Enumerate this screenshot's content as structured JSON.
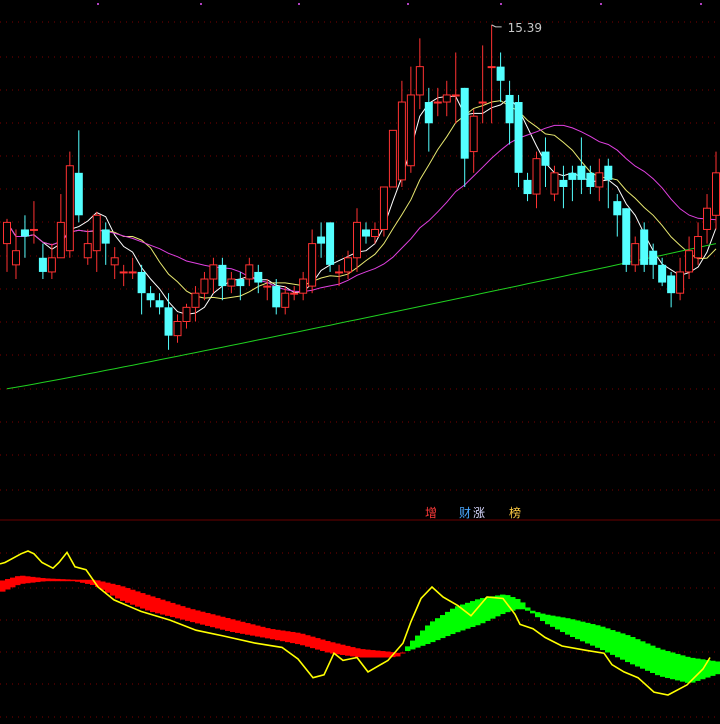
{
  "chart_data": {
    "type": "candlestick",
    "price_ylim": [
      9.3,
      15.6
    ],
    "max_label": "15.39",
    "candles": [
      [
        12.3,
        12.6,
        12.65,
        11.9
      ],
      [
        12.0,
        12.2,
        12.5,
        11.8
      ],
      [
        12.5,
        12.4,
        12.7,
        12.1
      ],
      [
        12.5,
        12.5,
        12.9,
        12.3
      ],
      [
        12.1,
        11.9,
        12.3,
        11.8
      ],
      [
        11.9,
        12.1,
        12.3,
        11.8
      ],
      [
        12.1,
        12.6,
        13.0,
        12.1
      ],
      [
        12.2,
        13.4,
        13.6,
        12.1
      ],
      [
        13.3,
        12.7,
        13.9,
        12.6
      ],
      [
        12.1,
        12.3,
        12.5,
        12.0
      ],
      [
        12.2,
        12.7,
        12.75,
        11.9
      ],
      [
        12.5,
        12.3,
        12.6,
        12.0
      ],
      [
        12.0,
        12.1,
        12.25,
        11.8
      ],
      [
        11.9,
        11.9,
        12.0,
        11.7
      ],
      [
        11.9,
        11.9,
        12.1,
        11.8
      ],
      [
        11.9,
        11.6,
        12.0,
        11.3
      ],
      [
        11.6,
        11.5,
        11.7,
        11.4
      ],
      [
        11.5,
        11.4,
        11.6,
        11.3
      ],
      [
        11.4,
        11.0,
        11.6,
        10.8
      ],
      [
        11.0,
        11.2,
        11.3,
        10.9
      ],
      [
        11.2,
        11.4,
        11.45,
        11.1
      ],
      [
        11.4,
        11.6,
        11.7,
        11.2
      ],
      [
        11.6,
        11.8,
        11.9,
        11.5
      ],
      [
        11.8,
        12.0,
        12.1,
        11.6
      ],
      [
        12.0,
        11.7,
        12.1,
        11.5
      ],
      [
        11.7,
        11.8,
        11.9,
        11.6
      ],
      [
        11.8,
        11.7,
        11.9,
        11.5
      ],
      [
        11.8,
        12.0,
        12.1,
        11.7
      ],
      [
        11.9,
        11.75,
        12.0,
        11.6
      ],
      [
        11.7,
        11.7,
        11.8,
        11.5
      ],
      [
        11.7,
        11.4,
        11.8,
        11.3
      ],
      [
        11.4,
        11.6,
        11.7,
        11.3
      ],
      [
        11.6,
        11.6,
        11.7,
        11.5
      ],
      [
        11.6,
        11.8,
        11.9,
        11.5
      ],
      [
        11.7,
        12.3,
        12.5,
        11.6
      ],
      [
        12.4,
        12.3,
        12.6,
        12.1
      ],
      [
        12.6,
        12.0,
        12.6,
        11.9
      ],
      [
        11.9,
        11.9,
        12.0,
        11.7
      ],
      [
        11.9,
        12.1,
        12.2,
        11.8
      ],
      [
        12.1,
        12.6,
        12.8,
        11.9
      ],
      [
        12.5,
        12.4,
        12.6,
        12.3
      ],
      [
        12.4,
        12.5,
        12.6,
        12.3
      ],
      [
        12.5,
        13.1,
        13.1,
        12.4
      ],
      [
        13.1,
        13.9,
        13.9,
        13.1
      ],
      [
        13.2,
        14.3,
        14.6,
        13.1
      ],
      [
        13.4,
        14.4,
        14.8,
        13.3
      ],
      [
        14.4,
        14.8,
        15.2,
        14.2
      ],
      [
        14.3,
        14.0,
        14.5,
        13.6
      ],
      [
        14.3,
        14.3,
        14.5,
        14.1
      ],
      [
        14.3,
        14.4,
        14.6,
        14.1
      ],
      [
        14.4,
        14.4,
        15.0,
        14.0
      ],
      [
        14.5,
        13.5,
        14.5,
        13.1
      ],
      [
        13.6,
        14.1,
        14.2,
        13.3
      ],
      [
        14.3,
        14.3,
        15.1,
        14.0
      ],
      [
        14.8,
        14.8,
        15.39,
        14.0
      ],
      [
        14.8,
        14.6,
        15.0,
        14.3
      ],
      [
        14.4,
        14.0,
        14.6,
        13.7
      ],
      [
        14.3,
        13.3,
        14.4,
        13.1
      ],
      [
        13.2,
        13.0,
        13.3,
        12.9
      ],
      [
        13.0,
        13.5,
        13.6,
        12.8
      ],
      [
        13.6,
        13.4,
        13.8,
        13.1
      ],
      [
        13.0,
        13.3,
        13.4,
        12.9
      ],
      [
        13.2,
        13.1,
        13.4,
        12.8
      ],
      [
        13.3,
        13.2,
        13.4,
        12.9
      ],
      [
        13.4,
        13.2,
        13.8,
        13.0
      ],
      [
        13.3,
        13.1,
        13.4,
        13.0
      ],
      [
        13.1,
        13.3,
        13.5,
        12.9
      ],
      [
        13.4,
        13.2,
        13.5,
        12.8
      ],
      [
        12.9,
        12.7,
        13.0,
        12.4
      ],
      [
        12.8,
        12.0,
        12.8,
        11.9
      ],
      [
        12.0,
        12.3,
        12.4,
        11.9
      ],
      [
        12.5,
        12.0,
        12.6,
        11.9
      ],
      [
        12.2,
        12.0,
        12.3,
        11.8
      ],
      [
        12.0,
        11.75,
        12.1,
        11.7
      ],
      [
        11.85,
        11.6,
        11.9,
        11.4
      ],
      [
        11.6,
        11.9,
        12.1,
        11.5
      ],
      [
        11.9,
        12.2,
        12.4,
        11.8
      ],
      [
        12.1,
        12.4,
        12.6,
        12.0
      ],
      [
        12.5,
        12.8,
        13.0,
        12.3
      ],
      [
        12.7,
        13.3,
        13.6,
        12.5
      ]
    ],
    "ma_colors": [
      "#ffffff",
      "#e8e870",
      "#e040e0",
      "#20d020"
    ],
    "up_color": "#ff3232",
    "down_color": "#54ffff",
    "indicator": {
      "labels": [
        {
          "text": "增",
          "color": "#ff3a3a"
        },
        {
          "text": "财",
          "color": "#4aa8ff"
        },
        {
          "text": "涨",
          "color": "#d8d8ff"
        },
        {
          "text": "榜",
          "color": "#ffcc44"
        }
      ],
      "ylim": [
        0,
        100
      ],
      "line_color": "#ffff00",
      "band_up_color": "#ff0000",
      "band_down_color": "#00ff00",
      "line": [
        [
          0,
          82
        ],
        [
          5,
          83
        ],
        [
          13,
          86
        ],
        [
          21,
          89
        ],
        [
          28,
          91
        ],
        [
          34,
          89
        ],
        [
          42,
          83
        ],
        [
          53,
          79
        ],
        [
          59,
          83
        ],
        [
          67,
          90
        ],
        [
          75,
          80
        ],
        [
          86,
          78
        ],
        [
          98,
          66
        ],
        [
          114,
          57
        ],
        [
          141,
          49
        ],
        [
          170,
          43
        ],
        [
          196,
          36
        ],
        [
          223,
          32
        ],
        [
          255,
          27
        ],
        [
          282,
          24
        ],
        [
          298,
          16
        ],
        [
          313,
          3
        ],
        [
          324,
          5
        ],
        [
          334,
          20
        ],
        [
          343,
          15
        ],
        [
          357,
          17
        ],
        [
          368,
          7
        ],
        [
          388,
          15
        ],
        [
          403,
          27
        ],
        [
          411,
          42
        ],
        [
          421,
          58
        ],
        [
          432,
          66
        ],
        [
          443,
          59
        ],
        [
          458,
          53
        ],
        [
          471,
          46
        ],
        [
          487,
          59
        ],
        [
          503,
          58
        ],
        [
          515,
          47
        ],
        [
          520,
          40
        ],
        [
          533,
          37
        ],
        [
          545,
          31
        ],
        [
          562,
          25
        ],
        [
          586,
          22
        ],
        [
          604,
          20
        ],
        [
          612,
          12
        ],
        [
          624,
          7
        ],
        [
          638,
          3
        ],
        [
          654,
          -7
        ],
        [
          668,
          -9
        ],
        [
          687,
          -2
        ],
        [
          703,
          9
        ],
        [
          710,
          17
        ]
      ],
      "band": [
        [
          0,
          62,
          70
        ],
        [
          20,
          68,
          74
        ],
        [
          45,
          70,
          72
        ],
        [
          75,
          70,
          71
        ],
        [
          95,
          67,
          71
        ],
        [
          120,
          57,
          67
        ],
        [
          150,
          49,
          60
        ],
        [
          190,
          42,
          51
        ],
        [
          230,
          35,
          44
        ],
        [
          270,
          30,
          37
        ],
        [
          300,
          26,
          34
        ],
        [
          330,
          20,
          28
        ],
        [
          360,
          17,
          23
        ],
        [
          390,
          17,
          21
        ],
        [
          400,
          18,
          20
        ],
        [
          410,
          27,
          22
        ],
        [
          430,
          41,
          27
        ],
        [
          455,
          52,
          34
        ],
        [
          480,
          58,
          40
        ],
        [
          505,
          61,
          48
        ],
        [
          520,
          57,
          51
        ],
        [
          530,
          50,
          49
        ],
        [
          545,
          47,
          41
        ],
        [
          570,
          44,
          32
        ],
        [
          600,
          39,
          23
        ],
        [
          630,
          32,
          13
        ],
        [
          660,
          23,
          4
        ],
        [
          690,
          17,
          -1
        ],
        [
          720,
          14,
          6
        ]
      ]
    }
  }
}
